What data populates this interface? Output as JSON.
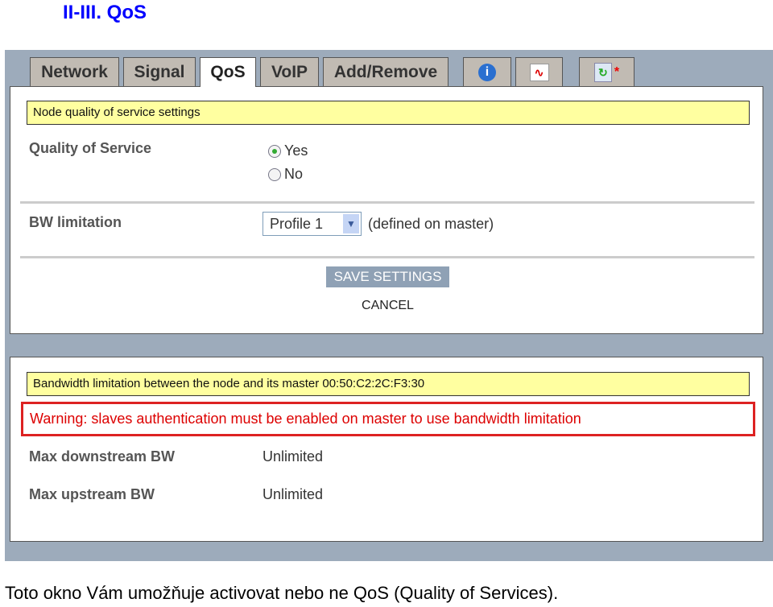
{
  "heading": "II-III. QoS",
  "tabs": [
    "Network",
    "Signal",
    "QoS",
    "VoIP",
    "Add/Remove"
  ],
  "icon_tabs": [
    "info-icon",
    "graph-icon",
    "update-icon"
  ],
  "panel1": {
    "title": "Node quality of service settings",
    "qos_label": "Quality of Service",
    "yes": "Yes",
    "no": "No",
    "qos_selected": "Yes",
    "bw_label": "BW limitation",
    "profile": "Profile 1",
    "profile_note": "(defined on master)",
    "save": "SAVE SETTINGS",
    "cancel": "CANCEL"
  },
  "panel2": {
    "title": "Bandwidth limitation between the node and its master 00:50:C2:2C:F3:30",
    "warning": "Warning: slaves authentication must be enabled on master to use bandwidth limitation",
    "down_label": "Max downstream BW",
    "down_value": "Unlimited",
    "up_label": "Max upstream BW",
    "up_value": "Unlimited"
  },
  "caption": "Toto okno Vám umožňuje activovat nebo ne QoS (Quality of Services).",
  "colors": {
    "heading": "#0000ff",
    "warning": "#dd0000",
    "bar": "#ffffa0",
    "frame": "#9dabbb"
  }
}
